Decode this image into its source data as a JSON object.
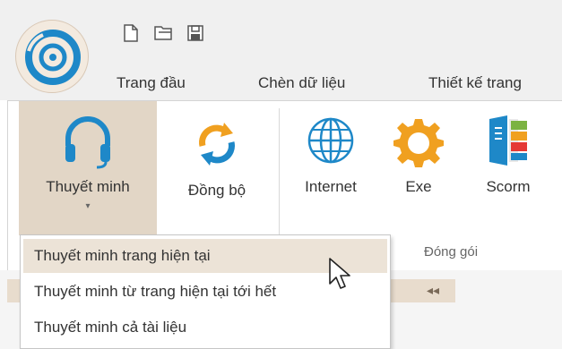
{
  "quick_access": {
    "icons": [
      "new-file-icon",
      "open-folder-icon",
      "save-icon"
    ]
  },
  "tabs": [
    {
      "label": "Trang đầu"
    },
    {
      "label": "Chèn dữ liệu"
    },
    {
      "label": "Thiết kế trang"
    }
  ],
  "ribbon": {
    "buttons": [
      {
        "label": "Thuyết minh",
        "icon": "headphones-icon"
      },
      {
        "label": "Đồng bộ",
        "icon": "sync-icon"
      },
      {
        "label": "Internet",
        "icon": "globe-icon"
      },
      {
        "label": "Exe",
        "icon": "exe-gear-icon"
      },
      {
        "label": "Scorm",
        "icon": "scorm-icon"
      }
    ],
    "groups": [
      {
        "label": "Đóng gói"
      }
    ]
  },
  "dropdown": {
    "items": [
      {
        "label": "Thuyết minh trang hiện tại"
      },
      {
        "label": "Thuyết minh từ trang hiện tại tới hết"
      },
      {
        "label": "Thuyết minh cả tài liệu"
      }
    ]
  },
  "colors": {
    "accent_blue": "#1e88c8",
    "accent_orange": "#f0a020",
    "active_bg": "#e2d6c6",
    "hover_bg": "#ece3d7"
  }
}
